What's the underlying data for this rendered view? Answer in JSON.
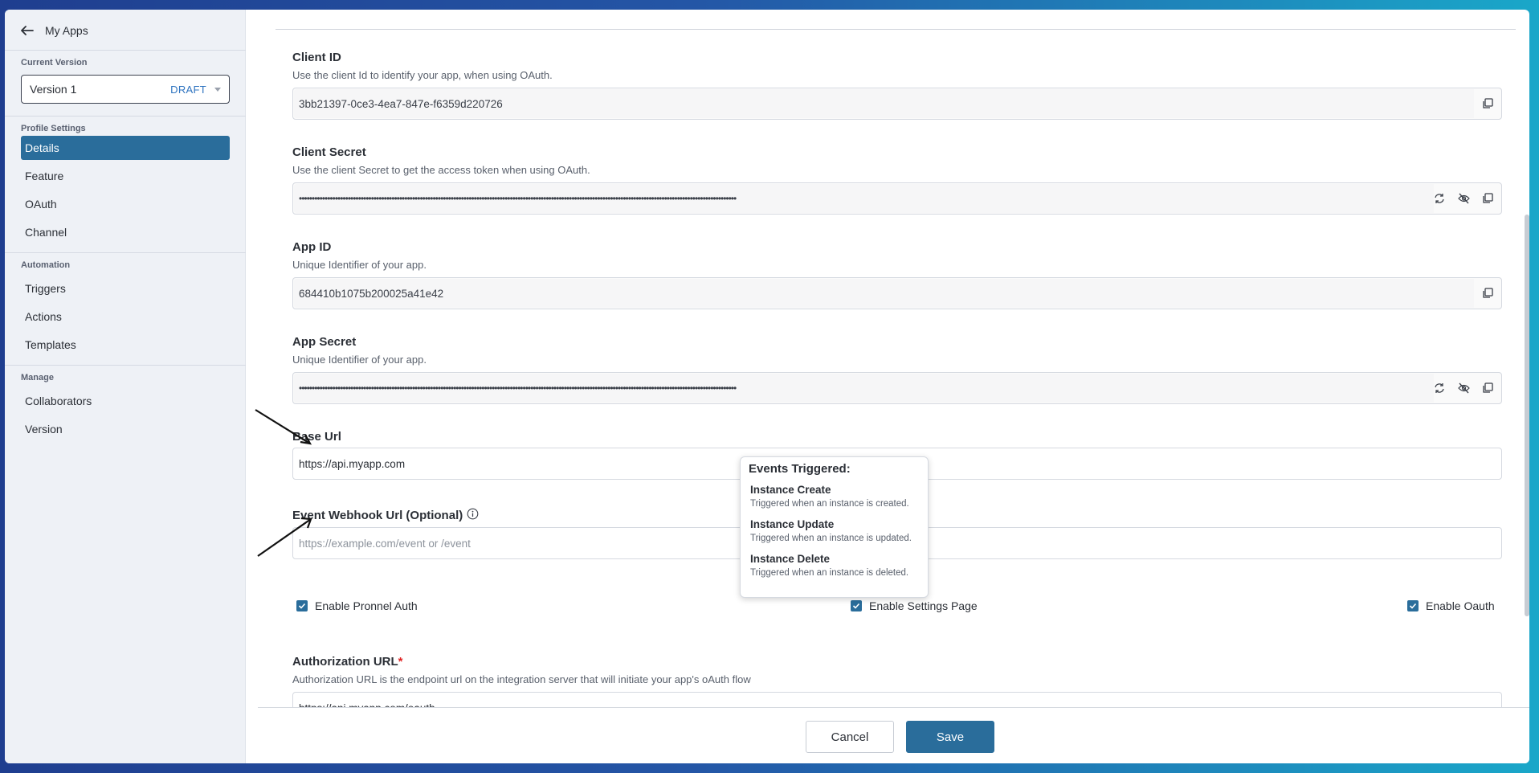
{
  "sidebar": {
    "back_label": "My Apps",
    "current_version_section": "Current Version",
    "version_name": "Version 1",
    "version_status": "DRAFT",
    "profile_section": "Profile Settings",
    "profile_items": [
      {
        "label": "Details",
        "active": true
      },
      {
        "label": "Feature",
        "active": false
      },
      {
        "label": "OAuth",
        "active": false
      },
      {
        "label": "Channel",
        "active": false
      }
    ],
    "automation_section": "Automation",
    "automation_items": [
      {
        "label": "Triggers"
      },
      {
        "label": "Actions"
      },
      {
        "label": "Templates"
      }
    ],
    "manage_section": "Manage",
    "manage_items": [
      {
        "label": "Collaborators"
      },
      {
        "label": "Version"
      }
    ]
  },
  "fields": {
    "client_id": {
      "label": "Client ID",
      "description": "Use the client Id to identify your app, when using OAuth.",
      "value": "3bb21397-0ce3-4ea7-847e-f6359d220726"
    },
    "client_secret": {
      "label": "Client Secret",
      "description": "Use the client Secret to get the access token when using OAuth.",
      "value": "••••••••••••••••••••••••••••••••••••••••••••••••••••••••••••••••••••••••••••••••••••••••••••••••••••••••••••••••••••••••••••••••••••••••••••••••••••••••••••••••••••••••••"
    },
    "app_id": {
      "label": "App ID",
      "description": "Unique Identifier of your app.",
      "value": "684410b1075b200025a41e42"
    },
    "app_secret": {
      "label": "App Secret",
      "description": "Unique Identifier of your app.",
      "value": "••••••••••••••••••••••••••••••••••••••••••••••••••••••••••••••••••••••••••••••••••••••••••••••••••••••••••••••••••••••••••••••••••••••••••••••••••••••••••••••••••••••••••"
    },
    "base_url": {
      "label": "Base Url",
      "value": "https://api.myapp.com"
    },
    "webhook_url": {
      "label": "Event Webhook Url (Optional)",
      "placeholder": "https://example.com/event or /event"
    },
    "authorization_url": {
      "label": "Authorization URL",
      "required_mark": "*",
      "description": "Authorization URL is the endpoint url on the integration server that will initiate your app's oAuth flow",
      "value": "https://api.myapp.com/oauth"
    }
  },
  "checkboxes": [
    {
      "label": "Enable Pronnel Auth",
      "checked": true
    },
    {
      "label": "Enable Settings Page",
      "checked": true
    },
    {
      "label": "Enable Oauth",
      "checked": true
    }
  ],
  "tooltip": {
    "title": "Events Triggered:",
    "items": [
      {
        "title": "Instance Create",
        "description": "Triggered when an instance is created."
      },
      {
        "title": "Instance Update",
        "description": "Triggered when an instance is updated."
      },
      {
        "title": "Instance Delete",
        "description": "Triggered when an instance is deleted."
      }
    ]
  },
  "footer": {
    "cancel_label": "Cancel",
    "save_label": "Save"
  },
  "colors": {
    "accent": "#2a6d9b",
    "required": "#e02020",
    "link_badge": "#2f74c0"
  },
  "icons": [
    "arrow-left-icon",
    "copy-icon",
    "refresh-icon",
    "eye-off-icon",
    "info-icon",
    "checkbox-checked-icon"
  ]
}
